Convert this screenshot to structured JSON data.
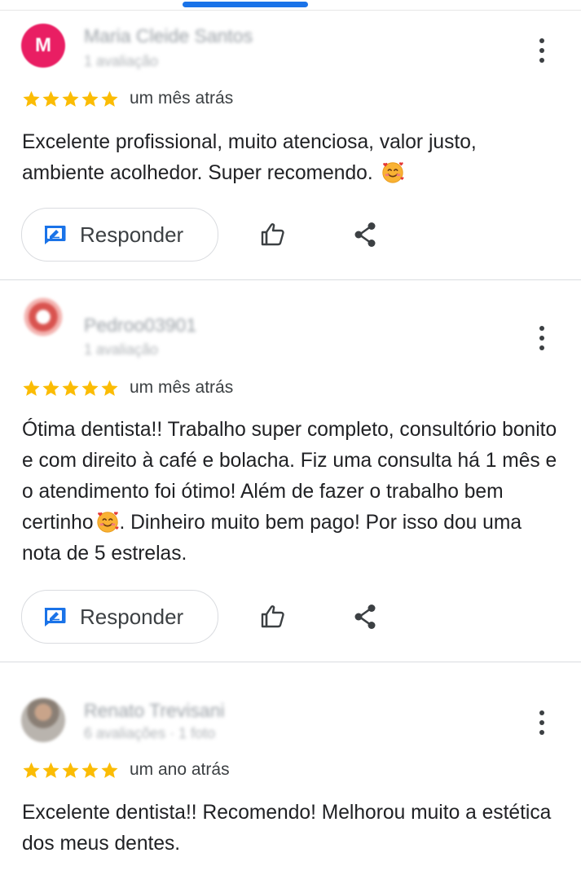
{
  "colors": {
    "star": "#fbbc04",
    "accent": "#1a73e8",
    "divider": "#dadce0"
  },
  "reviews": [
    {
      "author": "Maria Cleide Santos",
      "author_meta": "1 avaliação",
      "avatar_letter": "M",
      "rating": 5,
      "date": "um mês atrás",
      "text": "Excelente profissional, muito atenciosa, valor justo, ambiente acolhedor. Super recomendo.",
      "emoji": "smiling-face-with-hearts",
      "reply_label": "Responder"
    },
    {
      "author": "Pedroo03901",
      "author_meta": "1 avaliação",
      "rating": 5,
      "date": "um mês atrás",
      "text_before_emoji": "Ótima dentista!! Trabalho super completo, consultório bonito e com direito à café e bolacha. Fiz uma consulta há 1 mês e o atendimento foi ótimo! Além de fazer o trabalho bem certinho",
      "emoji": "smiling-face-with-hearts",
      "text_after_emoji": ". Dinheiro muito bem pago! Por isso dou uma nota de 5 estrelas.",
      "reply_label": "Responder"
    },
    {
      "author": "Renato Trevisani",
      "author_meta": "6 avaliações · 1 foto",
      "rating": 5,
      "date": "um ano atrás",
      "text": "Excelente dentista!! Recomendo! Melhorou muito a estética dos meus dentes."
    }
  ]
}
